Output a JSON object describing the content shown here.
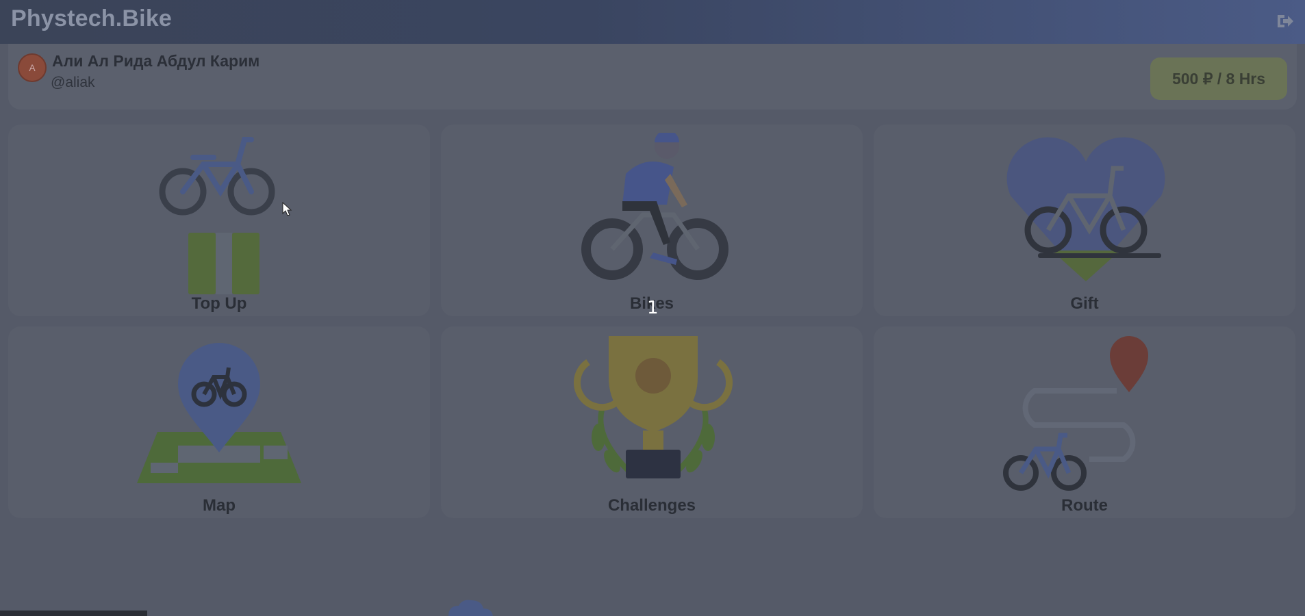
{
  "app": {
    "title": "Phystеch.Bike"
  },
  "header": {
    "logout_icon": "logout-icon"
  },
  "profile": {
    "avatar_initial": "A",
    "name": "Али Ал Рида Абдул Карим",
    "handle": "@aliak",
    "balance": "500 ₽ / 8 Hrs"
  },
  "tiles": [
    {
      "label": "Top Up",
      "icon": "bike-and-cash-icon"
    },
    {
      "label": "Bikes",
      "icon": "cyclist-icon"
    },
    {
      "label": "Gift",
      "icon": "heart-bike-icon"
    },
    {
      "label": "Map",
      "icon": "map-pin-icon"
    },
    {
      "label": "Challenges",
      "icon": "trophy-icon"
    },
    {
      "label": "Route",
      "icon": "route-icon"
    }
  ],
  "overlay": {
    "cursor_number": "1"
  }
}
